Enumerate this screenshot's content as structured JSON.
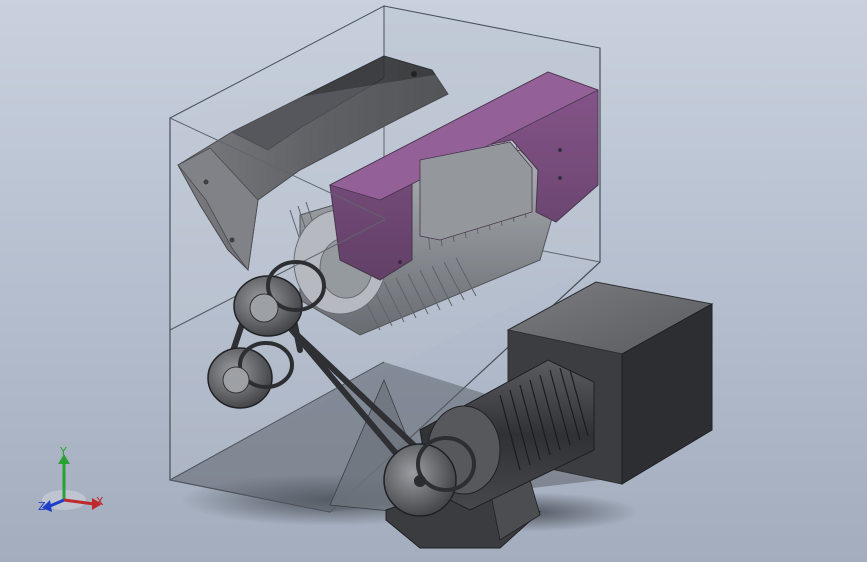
{
  "viewport": {
    "background_top": "#c9d1de",
    "background_bottom": "#a3adbd"
  },
  "model": {
    "part_colors": {
      "housing_glass": "#b9c2cf",
      "frame_edges": "#4a4f58",
      "hopper": "#5a5a5c",
      "rotor_cover": "#5c2a5e",
      "rotor_cover_light": "#7a3d7c",
      "rotor": "#8e9296",
      "motor_body": "#3c3e42",
      "gearbox": "#4d4f54",
      "pulley": "#3f4145",
      "belt": "#2e3034",
      "floor_shadow": "#4e535c"
    }
  },
  "triad": {
    "x_label": "X",
    "y_label": "Y",
    "z_label": "Z",
    "x_color": "#c0282a",
    "y_color": "#2aa133",
    "z_color": "#1f3fc7"
  }
}
